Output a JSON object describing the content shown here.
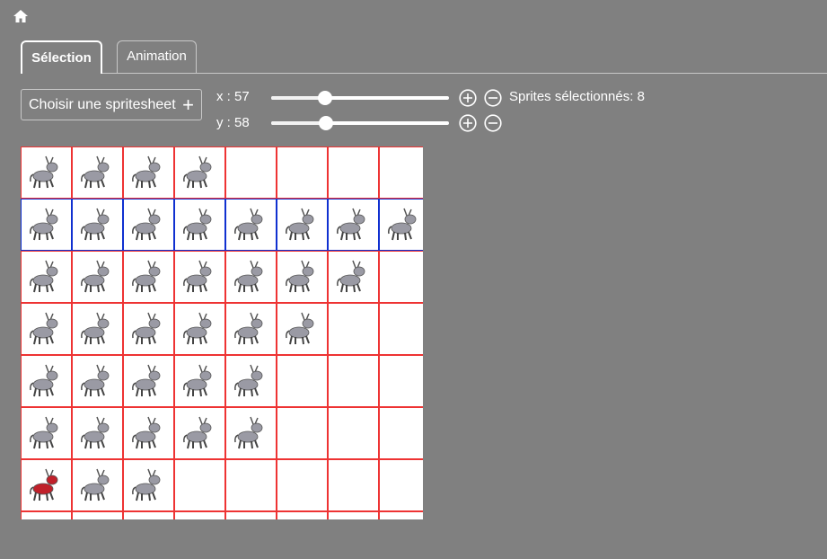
{
  "nav": {
    "home_icon": "home-icon"
  },
  "tabs": [
    {
      "label": "Sélection",
      "active": true
    },
    {
      "label": "Animation",
      "active": false
    }
  ],
  "toolbar": {
    "choose_label": "Choisir une spritesheet",
    "choose_icon": "+",
    "x_label": "x : 57",
    "y_label": "y : 58",
    "x_value": 57,
    "y_value": 58,
    "slider_min": 0,
    "slider_max": 200,
    "selected_text": "Sprites sélectionnés: 8"
  },
  "spritesheet": {
    "columns": 8,
    "rows": 8,
    "selected_row": 1,
    "row_counts": [
      4,
      8,
      7,
      6,
      5,
      5,
      3,
      0
    ],
    "highlight_color": "#c0202a",
    "sprite_color": "#9a9aa4",
    "grid_color": "#ee3333",
    "selection_color": "#1030d0",
    "sprite_icon": "donkey-sprite-icon",
    "special_sprites": [
      {
        "row": 6,
        "col": 0,
        "color": "#c0202a"
      }
    ]
  }
}
